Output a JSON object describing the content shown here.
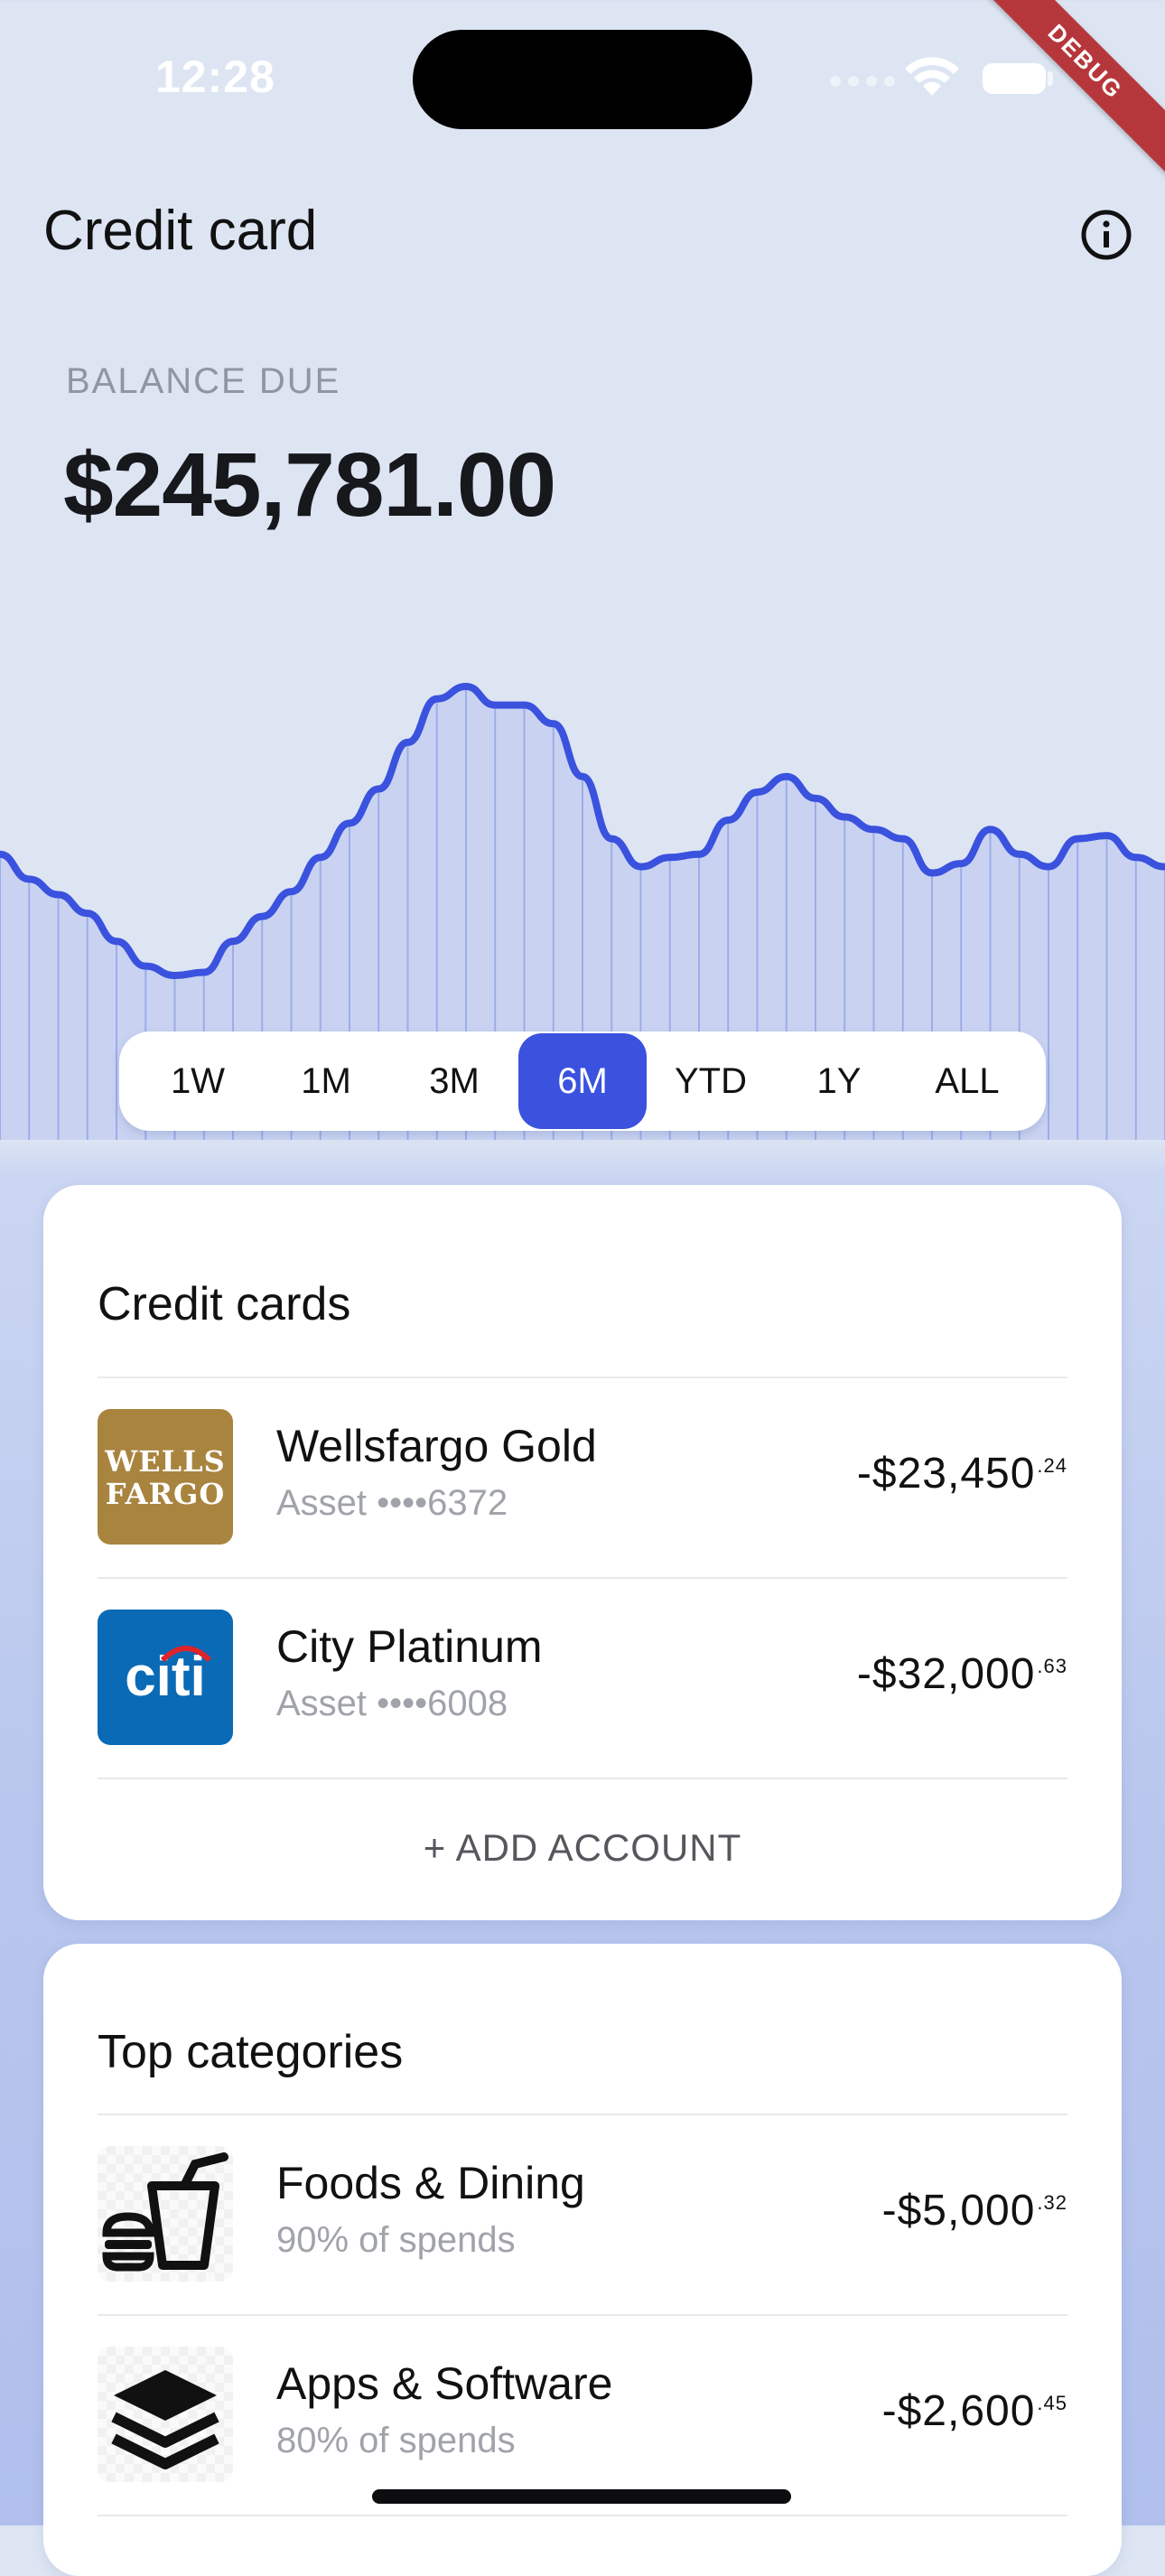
{
  "status_bar": {
    "time": "12:28",
    "debug_banner": "DEBUG"
  },
  "header": {
    "title": "Credit card",
    "info_icon": "info-circle-icon"
  },
  "balance": {
    "label": "BALANCE DUE",
    "amount": "$245,781.00"
  },
  "chart_data": {
    "type": "area",
    "x": [
      0,
      1,
      2,
      3,
      4,
      5,
      6,
      7,
      8,
      9,
      10,
      11,
      12,
      13,
      14,
      15,
      16,
      17,
      18,
      19,
      20,
      21,
      22,
      23,
      24,
      25,
      26,
      27,
      28,
      29,
      30,
      31,
      32,
      33,
      34,
      35,
      36,
      37,
      38,
      39,
      40
    ],
    "values": [
      50,
      42,
      37,
      31,
      22,
      14,
      11,
      12,
      22,
      30,
      38,
      49,
      60,
      71,
      86,
      100,
      104,
      98,
      98,
      92,
      75,
      55,
      46,
      49,
      50,
      61,
      70,
      75,
      68,
      62,
      58,
      55,
      44,
      47,
      58,
      50,
      46,
      55,
      56,
      49,
      46
    ],
    "color": "#3a52de",
    "fill": "#c9d3f1",
    "grid": false,
    "legend": "none"
  },
  "ranges": {
    "items": [
      "1W",
      "1M",
      "3M",
      "6M",
      "YTD",
      "1Y",
      "ALL"
    ],
    "active": "6M"
  },
  "credit_cards": {
    "title": "Credit cards",
    "items": [
      {
        "logo_text": "WELLS FARGO",
        "name": "Wellsfargo Gold",
        "sub": "Asset ••••6372",
        "amount": "-$23,450",
        "cents": ".24"
      },
      {
        "logo_text": "citi",
        "name": "City Platinum",
        "sub": "Asset ••••6008",
        "amount": "-$32,000",
        "cents": ".63"
      }
    ],
    "add_label": "+ ADD ACCOUNT"
  },
  "categories": {
    "title": "Top categories",
    "items": [
      {
        "icon": "food-drink-icon",
        "name": "Foods & Dining",
        "sub": "90% of spends",
        "amount": "-$5,000",
        "cents": ".32"
      },
      {
        "icon": "layers-stack-icon",
        "name": "Apps & Software",
        "sub": "80% of spends",
        "amount": "-$2,600",
        "cents": ".45"
      }
    ]
  }
}
